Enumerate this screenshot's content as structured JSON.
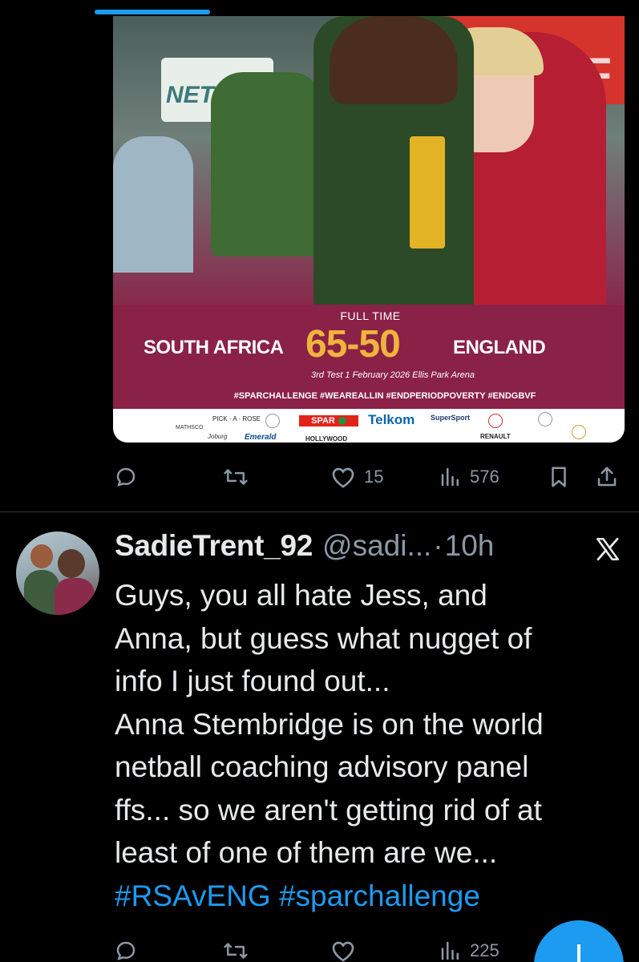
{
  "media_card": {
    "banner_text": "SF",
    "sign_text": "NETB",
    "full_time": "FULL TIME",
    "team_home": "SOUTH AFRICA",
    "score": "65-50",
    "team_away": "ENGLAND",
    "match_info": "3rd Test 1 February 2026 Ellis Park Arena",
    "hashtags": "#SPARCHALLENGE #WEAREALLIN #ENDPERIODPOVERTY #ENDGBVF",
    "sponsors": {
      "spar": "SPAR",
      "telkom": "Telkom",
      "supersport": "SuperSport",
      "pick_n_rose": "PICK · A · ROSE",
      "mathco": "MATHSCO",
      "joburg": "Joburg",
      "emerald": "Emerald",
      "hollywood": "HOLLYWOOD",
      "renault": "RENAULT"
    }
  },
  "first_tweet_actions": {
    "reply_icon": "reply-icon",
    "retweet_icon": "retweet-icon",
    "like_count": "15",
    "views_count": "576",
    "bookmark_icon": "bookmark-icon",
    "share_icon": "share-icon"
  },
  "tweet": {
    "display_name": "SadieTrent_92",
    "handle": "@sadi...",
    "separator": "·",
    "time": "10h",
    "lines": [
      "Guys, you all hate Jess, and",
      "Anna, but guess what nugget of",
      "info I just found out...",
      "Anna Stembridge is on the world",
      "netball coaching advisory panel",
      "ffs... so we aren't getting rid of at",
      "least of one of them are we..."
    ],
    "hashtag_1": "#RSAvENG",
    "hashtag_2": "#sparchallenge"
  },
  "second_tweet_actions": {
    "views_count": "225"
  },
  "colors": {
    "background": "#000000",
    "accent": "#1d9bf0",
    "muted": "#8b98a5",
    "text": "#e7e9ea",
    "card_maroon": "#8a2146",
    "score_gold": "#f0b43c"
  }
}
